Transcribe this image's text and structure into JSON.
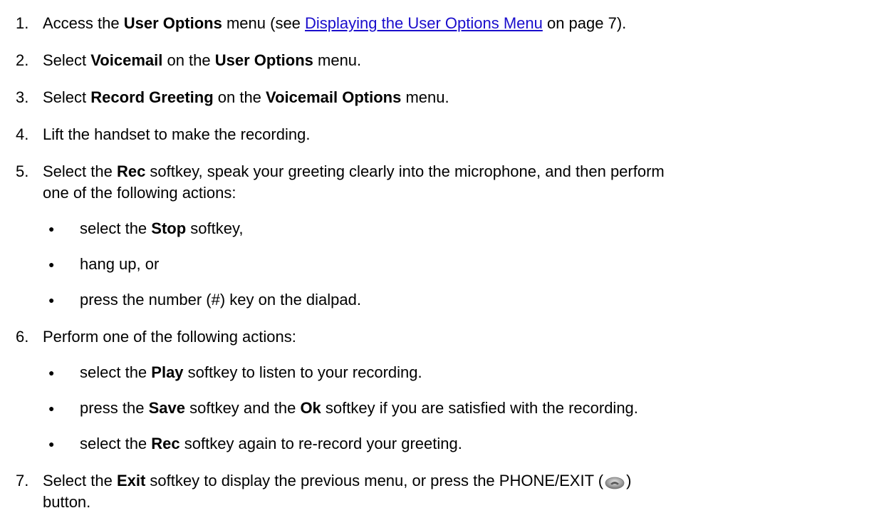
{
  "steps": [
    {
      "num": "1.",
      "t1": "Access the ",
      "b1": "User Options",
      "t2": " menu (see ",
      "link": "Displaying the User Options Menu",
      "t3": " on page 7)."
    },
    {
      "num": "2.",
      "t1": "Select ",
      "b1": "Voicemail",
      "t2": " on the ",
      "b2": "User Options",
      "t3": " menu."
    },
    {
      "num": "3.",
      "t1": "Select ",
      "b1": "Record Greeting",
      "t2": " on the ",
      "b2": "Voicemail Options",
      "t3": " menu."
    },
    {
      "num": "4.",
      "t1": "Lift the handset to make the recording."
    },
    {
      "num": "5.",
      "t1": "Select the ",
      "b1": "Rec",
      "t2": " softkey, speak your greeting clearly into the microphone, and then perform",
      "line2": "one of the following actions:"
    },
    {
      "num": "6.",
      "t1": "Perform one of the following actions:"
    },
    {
      "num": "7.",
      "t1": "Select the ",
      "b1": "Exit",
      "t2": " softkey to display the previous menu, or press the PHONE/EXIT (",
      "t3": ")",
      "line2": "button."
    }
  ],
  "bullets5": [
    {
      "t1": "select the ",
      "b1": "Stop",
      "t2": " softkey,"
    },
    {
      "t1": "hang up, or"
    },
    {
      "t1": "press the number (#) key on the dialpad."
    }
  ],
  "bullets6": [
    {
      "t1": "select the ",
      "b1": "Play",
      "t2": " softkey to listen to your recording."
    },
    {
      "t1": "press the ",
      "b1": "Save",
      "t2": " softkey and the ",
      "b2": "Ok",
      "t3": " softkey if you are satisfied with the recording."
    },
    {
      "t1": "select the ",
      "b1": "Rec",
      "t2": " softkey again to re-record your greeting."
    }
  ],
  "bullet_glyph": "●",
  "phone_icon": "phone-exit-icon"
}
